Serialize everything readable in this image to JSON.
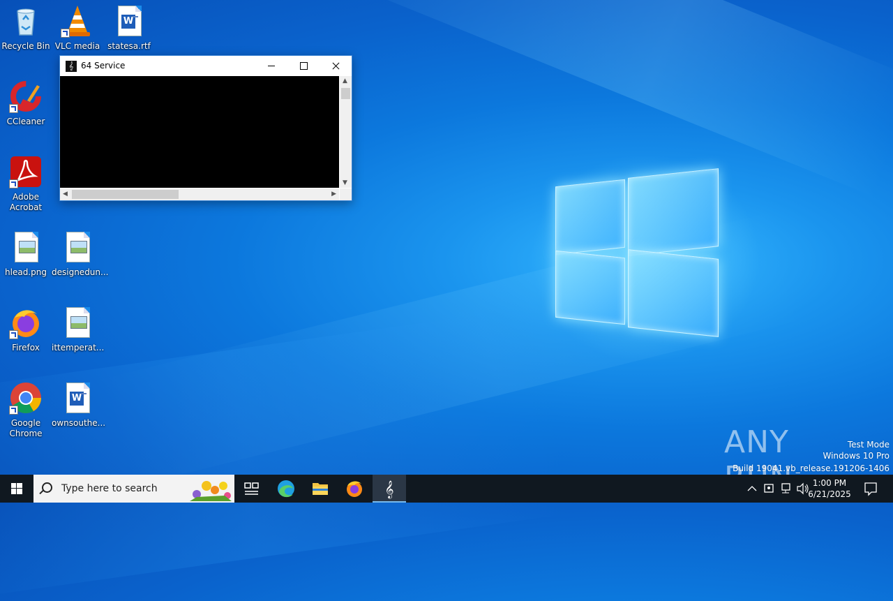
{
  "desktop": {
    "icons": [
      {
        "label": "Recycle Bin"
      },
      {
        "label": "VLC media"
      },
      {
        "label": "statesa.rtf"
      },
      {
        "label": "CCleaner"
      },
      {
        "label": "Adobe Acrobat"
      },
      {
        "label": "hlead.png"
      },
      {
        "label": "designedun..."
      },
      {
        "label": "Firefox"
      },
      {
        "label": "ittemperat..."
      },
      {
        "label": "Google Chrome"
      },
      {
        "label": "ownsouthe..."
      }
    ]
  },
  "window": {
    "title": "64 Service"
  },
  "watermark": {
    "brand": "ANY RUN",
    "line1": "Test Mode",
    "line2": "Windows 10 Pro",
    "line3": "Build 19041.vb_release.191206-1406"
  },
  "taskbar": {
    "search_placeholder": "Type here to search",
    "time": "1:00 PM",
    "date": "6/21/2025"
  },
  "colors": {
    "desktop_bg": "#0a6fd6",
    "taskbar_bg": "#101820",
    "window_border": "#3b83d3",
    "console_bg": "#000000"
  }
}
